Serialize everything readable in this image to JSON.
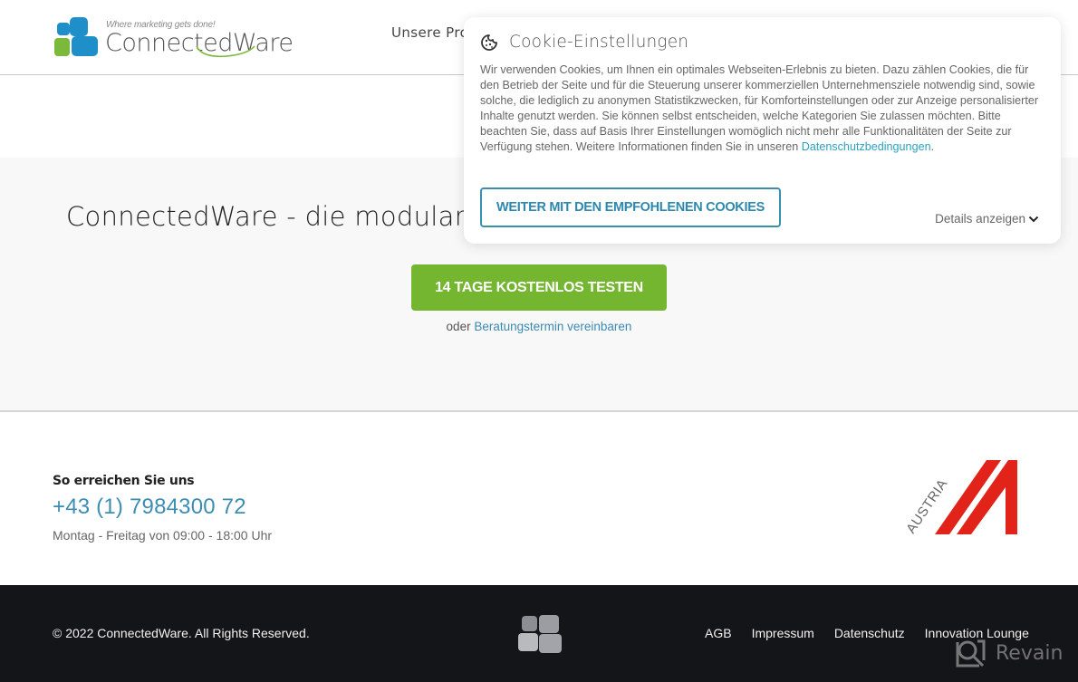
{
  "header": {
    "logo": {
      "tagline": "Where marketing gets done!",
      "name": "ConnectedWare",
      "colors": {
        "blue": "#1e8fc9",
        "green": "#7ab93a"
      }
    },
    "nav": [
      {
        "label": "Unsere Pro",
        "icon": null
      }
    ]
  },
  "hero": {
    "title": "ConnectedWare - die modulare",
    "cta_label": "14 TAGE KOSTENLOS TESTEN",
    "cta_color": "#75b631",
    "secondary_prefix": "oder",
    "secondary_link": "Beratungstermin vereinbaren"
  },
  "contact": {
    "label": "So erreichen Sie uns",
    "phone": "+43 (1) 7984300 72",
    "hours": "Montag - Freitag von 09:00 - 18:00 Uhr",
    "badge_text": "AUSTRIA",
    "badge_color": "#e2231a"
  },
  "footer": {
    "copyright": "© 2022 ConnectedWare. All Rights Reserved.",
    "links": [
      "AGB",
      "Impressum",
      "Datenschutz",
      "Innovation Lounge"
    ],
    "watermark": "Revain"
  },
  "cookie_banner": {
    "icon": "cookie-icon",
    "title": "Cookie-Einstellungen",
    "body": "Wir verwenden Cookies, um Ihnen ein optimales Webseiten-Erlebnis zu bieten. Dazu zählen Cookies, die für den Betrieb der Seite und für die Steuerung unserer kommerziellen Unternehmensziele notwendig sind, sowie solche, die lediglich zu anonymen Statistikzwecken, für Komforteinstellungen oder zur Anzeige personalisierter Inhalte genutzt werden. Sie können selbst entscheiden, welche Kategorien Sie zulassen möchten. Bitte beachten Sie, dass auf Basis Ihrer Einstellungen womöglich nicht mehr alle Funktionalitäten der Seite zur Verfügung stehen. Weitere Informationen finden Sie in unseren ",
    "privacy_link": "Datenschutzbedingungen",
    "body_end": ".",
    "accept_label": "WEITER MIT DEN EMPFOHLENEN COOKIES",
    "details_label": "Details anzeigen",
    "accent_color": "#3a8fad"
  }
}
